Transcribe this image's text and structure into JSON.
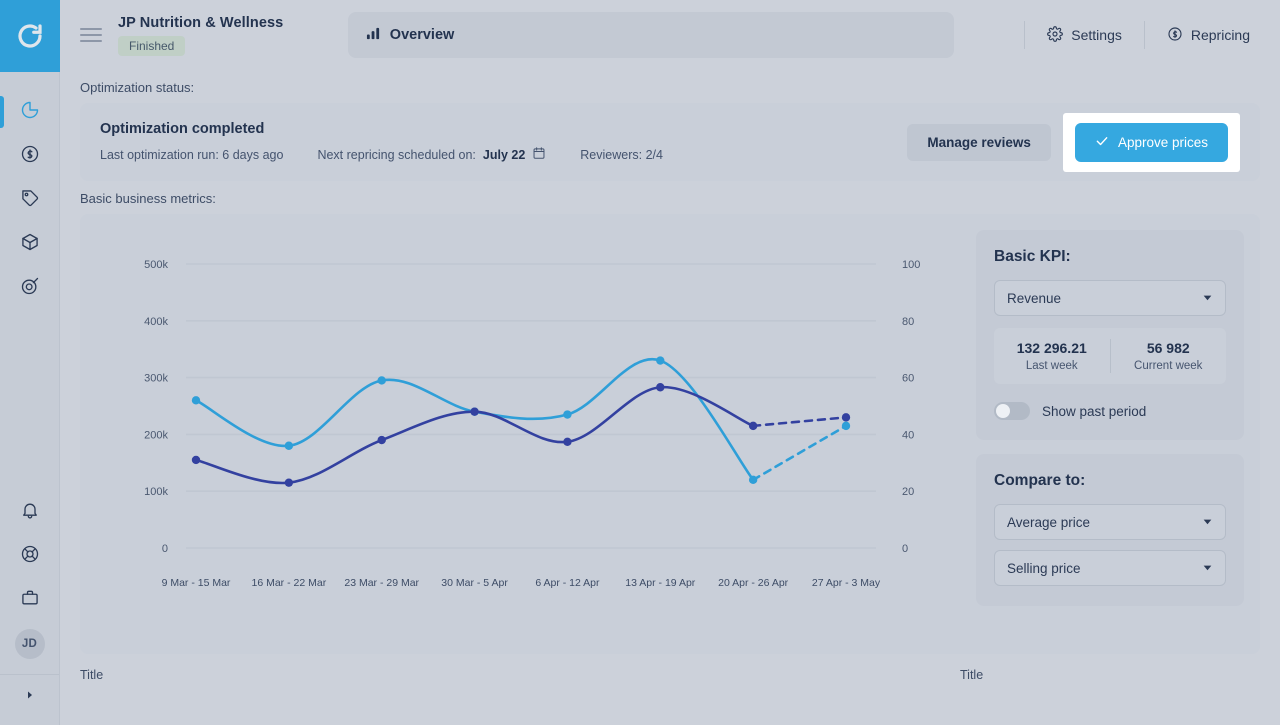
{
  "rail": {
    "logo_icon": "circular-refresh-logo",
    "items": [
      {
        "icon": "pie-chart-icon",
        "name": "dashboard",
        "active": true
      },
      {
        "icon": "dollar-refresh-icon",
        "name": "repricing",
        "active": false
      },
      {
        "icon": "tag-icon",
        "name": "pricing",
        "active": false
      },
      {
        "icon": "box-icon",
        "name": "products",
        "active": false
      },
      {
        "icon": "target-icon",
        "name": "strategy",
        "active": false
      }
    ],
    "bottom_items": [
      {
        "icon": "bell-icon",
        "name": "notifications"
      },
      {
        "icon": "life-ring-icon",
        "name": "support"
      },
      {
        "icon": "briefcase-icon",
        "name": "business"
      }
    ],
    "avatar_initials": "JD",
    "expand_icon": "expand-arrow-icon"
  },
  "topbar": {
    "menu_icon": "hamburger-menu-icon",
    "shop_title": "JP Nutrition & Wellness",
    "status_badge": "Finished",
    "tab_label": "Overview",
    "tab_icon": "bar-chart-icon",
    "settings_label": "Settings",
    "settings_icon": "gear-icon",
    "repricing_label": "Repricing",
    "repricing_icon": "dollar-circle-icon"
  },
  "status": {
    "section_label": "Optimization status:",
    "heading": "Optimization completed",
    "last_run_label": "Last optimization run: 6 days ago",
    "next_run_prefix": "Next repricing scheduled on:",
    "next_run_date": "July 22",
    "calendar_icon": "calendar-icon",
    "reviewers_label": "Reviewers: 2/4",
    "manage_reviews_label": "Manage reviews",
    "approve_prices_label": "Approve prices",
    "approve_icon": "check-icon",
    "approve_color": "#35a8e0"
  },
  "metrics": {
    "section_label": "Basic business metrics:"
  },
  "kpi": {
    "title": "Basic KPI:",
    "selected_metric": "Revenue",
    "caret_icon": "chevron-down-icon",
    "last_week_value": "132 296.21",
    "last_week_label": "Last week",
    "current_week_value": "56 982",
    "current_week_label": "Current week",
    "toggle_label": "Show past period",
    "toggle_on": false
  },
  "compare": {
    "title": "Compare to:",
    "option_one": "Average price",
    "option_two": "Selling price",
    "caret_icon": "chevron-down-icon"
  },
  "bottom": {
    "left_title": "Title",
    "right_title": "Title"
  },
  "chart_data": {
    "type": "line",
    "title": "",
    "xlabel": "",
    "ylabel": "",
    "grid": true,
    "legend": "none",
    "categories": [
      "9 Mar - 15 Mar",
      "16 Mar - 22 Mar",
      "23 Mar - 29 Mar",
      "30 Mar - 5 Apr",
      "6 Apr - 12 Apr",
      "13 Apr - 19 Apr",
      "20 Apr - 26 Apr",
      "27 Apr - 3 May"
    ],
    "left_axis": {
      "ticks": [
        "0",
        "100k",
        "200k",
        "300k",
        "400k",
        "500k"
      ],
      "min": 0,
      "max": 500000
    },
    "right_axis": {
      "ticks": [
        "0",
        "20",
        "40",
        "60",
        "80",
        "100"
      ],
      "min": 0,
      "max": 100
    },
    "series": [
      {
        "name": "Revenue",
        "color": "#2f9fd8",
        "axis": "left",
        "values": [
          260000,
          180000,
          295000,
          240000,
          235000,
          330000,
          120000,
          215000
        ],
        "dashed_from_index": 6
      },
      {
        "name": "Average price",
        "color": "#3341a0",
        "axis": "left",
        "values": [
          155000,
          115000,
          190000,
          240000,
          187000,
          283000,
          215000,
          230000
        ],
        "dashed_from_index": 6
      }
    ]
  }
}
